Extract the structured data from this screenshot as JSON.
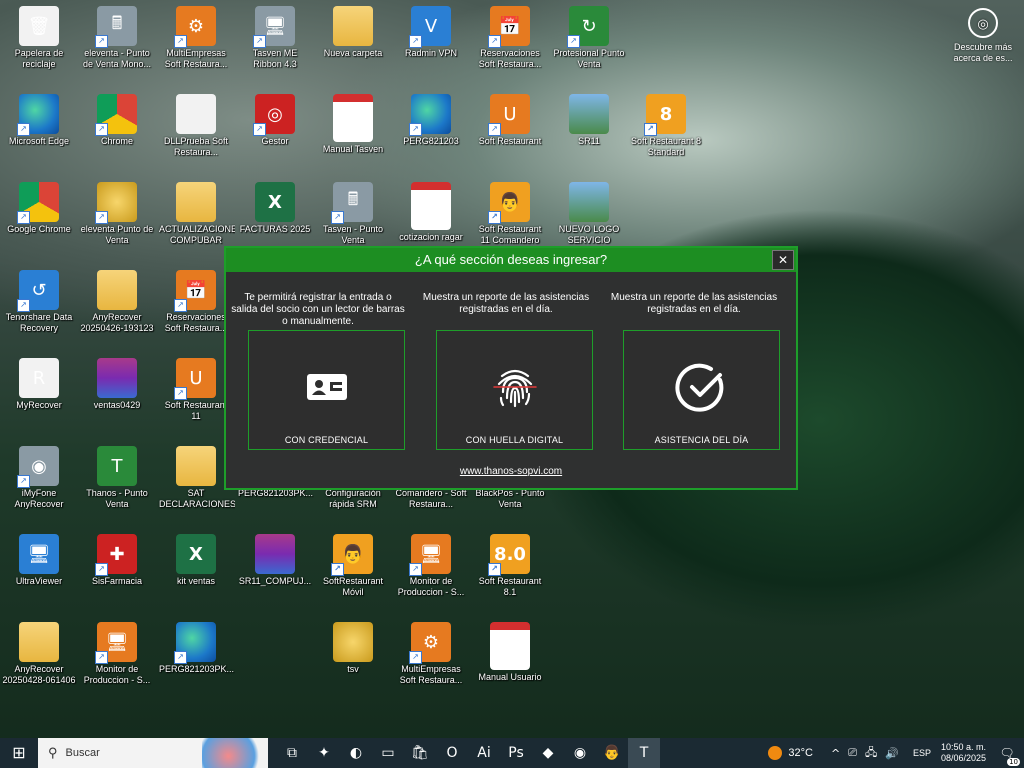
{
  "desktop": {
    "icons": [
      {
        "label": "Papelera de reciclaje",
        "icon": "recycle-bin-icon",
        "glyph": "🗑",
        "cls": "g-white",
        "col": 0,
        "row": 0,
        "shortcut": false
      },
      {
        "label": "eleventa - Punto de Venta Mono...",
        "icon": "pos-terminal-icon",
        "glyph": "🖩",
        "cls": "g-gray",
        "col": 1,
        "row": 0,
        "shortcut": true
      },
      {
        "label": "MultiEmpresas Soft Restaura...",
        "icon": "multiempresas-icon",
        "glyph": "⚙",
        "cls": "g-orange",
        "col": 2,
        "row": 0,
        "shortcut": true
      },
      {
        "label": "Tasven ME Ribbon 4.3",
        "icon": "tasven-icon",
        "glyph": "🖥",
        "cls": "g-gray",
        "col": 3,
        "row": 0,
        "shortcut": true
      },
      {
        "label": "Nueva carpeta",
        "icon": "folder-icon",
        "glyph": "",
        "cls": "g-folder",
        "col": 4,
        "row": 0,
        "shortcut": false
      },
      {
        "label": "Radmin VPN",
        "icon": "radmin-vpn-icon",
        "glyph": "V",
        "cls": "g-blue",
        "col": 5,
        "row": 0,
        "shortcut": true
      },
      {
        "label": "Reservaciones Soft Restaura...",
        "icon": "reservaciones-icon",
        "glyph": "📅",
        "cls": "g-orange",
        "col": 6,
        "row": 0,
        "shortcut": true
      },
      {
        "label": "Protesional Punto Venta",
        "icon": "punto-venta-icon",
        "glyph": "↻",
        "cls": "g-green",
        "col": 7,
        "row": 0,
        "shortcut": true
      },
      {
        "label": "Microsoft Edge",
        "icon": "edge-icon",
        "glyph": "",
        "cls": "g-edge",
        "col": 0,
        "row": 1,
        "shortcut": true
      },
      {
        "label": "Chrome",
        "icon": "chrome-icon",
        "glyph": "",
        "cls": "g-chrome",
        "col": 1,
        "row": 1,
        "shortcut": true
      },
      {
        "label": "DLLPrueba Soft Restaura...",
        "icon": "file-icon",
        "glyph": "",
        "cls": "g-white",
        "col": 2,
        "row": 1,
        "shortcut": false
      },
      {
        "label": "Gestor",
        "icon": "gestor-icon",
        "glyph": "◎",
        "cls": "g-red",
        "col": 3,
        "row": 1,
        "shortcut": true
      },
      {
        "label": "Manual Tasven",
        "icon": "pdf-icon",
        "glyph": "PDF",
        "cls": "g-pdf",
        "col": 4,
        "row": 1,
        "shortcut": false
      },
      {
        "label": "PERG821203",
        "icon": "edge-icon",
        "glyph": "",
        "cls": "g-edge",
        "col": 5,
        "row": 1,
        "shortcut": true
      },
      {
        "label": "Soft Restaurant",
        "icon": "soft-restaurant-icon",
        "glyph": "U",
        "cls": "g-orange",
        "col": 6,
        "row": 1,
        "shortcut": true
      },
      {
        "label": "SR11",
        "icon": "image-icon",
        "glyph": "",
        "cls": "g-img",
        "col": 7,
        "row": 1,
        "shortcut": false
      },
      {
        "label": "Soft Restaurant 8 Standard",
        "icon": "soft-restaurant-8-icon",
        "glyph": "8",
        "cls": "g-sr",
        "col": 8,
        "row": 1,
        "shortcut": true
      },
      {
        "label": "Google Chrome",
        "icon": "chrome-icon",
        "glyph": "",
        "cls": "g-chrome",
        "col": 0,
        "row": 2,
        "shortcut": true
      },
      {
        "label": "eleventa Punto de Venta",
        "icon": "coins-icon",
        "glyph": "",
        "cls": "g-coins",
        "col": 1,
        "row": 2,
        "shortcut": true
      },
      {
        "label": "ACTUALIZACIONES COMPUBAR",
        "icon": "folder-icon",
        "glyph": "",
        "cls": "g-folder",
        "col": 2,
        "row": 2,
        "shortcut": false
      },
      {
        "label": "FACTURAS 2025",
        "icon": "excel-icon",
        "glyph": "X",
        "cls": "g-excel",
        "col": 3,
        "row": 2,
        "shortcut": false
      },
      {
        "label": "Tasven - Punto Venta",
        "icon": "pos-terminal-icon",
        "glyph": "🖩",
        "cls": "g-gray",
        "col": 4,
        "row": 2,
        "shortcut": true
      },
      {
        "label": "cotizacion ragar",
        "icon": "pdf-icon",
        "glyph": "PDF",
        "cls": "g-pdf",
        "col": 5,
        "row": 2,
        "shortcut": false
      },
      {
        "label": "Soft Restaurant 11 Comandero",
        "icon": "comandero-icon",
        "glyph": "👨",
        "cls": "g-sr",
        "col": 6,
        "row": 2,
        "shortcut": true
      },
      {
        "label": "NUEVO LOGO SERVICIO",
        "icon": "image-icon",
        "glyph": "",
        "cls": "g-img",
        "col": 7,
        "row": 2,
        "shortcut": false
      },
      {
        "label": "Tenorshare Data Recovery",
        "icon": "data-recovery-icon",
        "glyph": "↺",
        "cls": "g-blue",
        "col": 0,
        "row": 3,
        "shortcut": true
      },
      {
        "label": "AnyRecover 20250426-193123",
        "icon": "folder-icon",
        "glyph": "",
        "cls": "g-folder",
        "col": 1,
        "row": 3,
        "shortcut": false
      },
      {
        "label": "Reservaciones Soft Restaura...",
        "icon": "reservaciones-icon",
        "glyph": "📅",
        "cls": "g-orange",
        "col": 2,
        "row": 3,
        "shortcut": true
      },
      {
        "label": "MyRecover",
        "icon": "myrecover-icon",
        "glyph": "R",
        "cls": "g-white",
        "col": 0,
        "row": 4,
        "shortcut": false
      },
      {
        "label": "ventas0429",
        "icon": "winrar-icon",
        "glyph": "",
        "cls": "g-rar",
        "col": 1,
        "row": 4,
        "shortcut": false
      },
      {
        "label": "Soft Restaurant 11",
        "icon": "soft-restaurant-icon",
        "glyph": "U",
        "cls": "g-orange",
        "col": 2,
        "row": 4,
        "shortcut": true
      },
      {
        "label": "iMyFone AnyRecover",
        "icon": "anyrecover-icon",
        "glyph": "◉",
        "cls": "g-gray",
        "col": 0,
        "row": 5,
        "shortcut": true
      },
      {
        "label": "Thanos - Punto Venta",
        "icon": "thanos-icon",
        "glyph": "T",
        "cls": "g-green",
        "col": 1,
        "row": 5,
        "shortcut": false
      },
      {
        "label": "SAT DECLARACIONES",
        "icon": "folder-icon",
        "glyph": "",
        "cls": "g-folder",
        "col": 2,
        "row": 5,
        "shortcut": false
      },
      {
        "label": "PERG821203PK...",
        "icon": "file-icon",
        "glyph": "",
        "cls": "g-white",
        "col": 3,
        "row": 5,
        "shortcut": false
      },
      {
        "label": "Configuración rápida SRM",
        "icon": "config-icon",
        "glyph": "⚙",
        "cls": "g-orange",
        "col": 4,
        "row": 5,
        "shortcut": true
      },
      {
        "label": "Comandero - Soft Restaura...",
        "icon": "comandero-icon",
        "glyph": "👨",
        "cls": "g-sr",
        "col": 5,
        "row": 5,
        "shortcut": true
      },
      {
        "label": "BlackPos - Punto Venta",
        "icon": "blackpos-icon",
        "glyph": "▣",
        "cls": "g-gray",
        "col": 6,
        "row": 5,
        "shortcut": true
      },
      {
        "label": "UltraViewer",
        "icon": "ultraviewer-icon",
        "glyph": "🖥",
        "cls": "g-blue",
        "col": 0,
        "row": 6,
        "shortcut": false
      },
      {
        "label": "SisFarmacia",
        "icon": "sisfarmacia-icon",
        "glyph": "✚",
        "cls": "g-red",
        "col": 1,
        "row": 6,
        "shortcut": true
      },
      {
        "label": "kit ventas",
        "icon": "excel-icon",
        "glyph": "X",
        "cls": "g-excel",
        "col": 2,
        "row": 6,
        "shortcut": false
      },
      {
        "label": "SR11_COMPUJ...",
        "icon": "winrar-icon",
        "glyph": "",
        "cls": "g-rar",
        "col": 3,
        "row": 6,
        "shortcut": false
      },
      {
        "label": "SoftRestaurant Móvil",
        "icon": "sr-movil-icon",
        "glyph": "👨",
        "cls": "g-sr",
        "col": 4,
        "row": 6,
        "shortcut": true
      },
      {
        "label": "Monitor de Produccion - S...",
        "icon": "monitor-icon",
        "glyph": "🖥",
        "cls": "g-orange",
        "col": 5,
        "row": 6,
        "shortcut": true
      },
      {
        "label": "Soft Restaurant 8.1",
        "icon": "soft-restaurant-8-icon",
        "glyph": "8.0",
        "cls": "g-sr",
        "col": 6,
        "row": 6,
        "shortcut": true
      },
      {
        "label": "AnyRecover 20250428-061406",
        "icon": "folder-icon",
        "glyph": "",
        "cls": "g-folder",
        "col": 0,
        "row": 7,
        "shortcut": false
      },
      {
        "label": "Monitor de Produccion - S...",
        "icon": "monitor-icon",
        "glyph": "🖥",
        "cls": "g-orange",
        "col": 1,
        "row": 7,
        "shortcut": true
      },
      {
        "label": "PERG821203PK...",
        "icon": "edge-icon",
        "glyph": "",
        "cls": "g-edge",
        "col": 2,
        "row": 7,
        "shortcut": true
      },
      {
        "label": "tsv",
        "icon": "coins-icon",
        "glyph": "",
        "cls": "g-coins",
        "col": 4,
        "row": 7,
        "shortcut": false
      },
      {
        "label": "MultiEmpresas Soft Restaura...",
        "icon": "multiempresas-icon",
        "glyph": "⚙",
        "cls": "g-orange",
        "col": 5,
        "row": 7,
        "shortcut": true
      },
      {
        "label": "Manual Usuario",
        "icon": "pdf-icon",
        "glyph": "PDF",
        "cls": "g-pdf",
        "col": 6,
        "row": 7,
        "shortcut": false
      }
    ],
    "discover": {
      "text": "Descubre más acerca de es...",
      "icon": "camera-icon",
      "glyph": "◎"
    }
  },
  "dialog": {
    "title": "¿A qué sección deseas ingresar?",
    "close": "✕",
    "options": [
      {
        "description": "Te permitirá registrar la entrada o salida del socio con un lector de barras o manualmente.",
        "label": "CON CREDENCIAL",
        "icon": "id-card-icon"
      },
      {
        "description": "Muestra un reporte de las asistencias registradas en el día.",
        "label": "CON HUELLA DIGITAL",
        "icon": "fingerprint-icon"
      },
      {
        "description": "Muestra un reporte de las asistencias registradas en el día.",
        "label": "ASISTENCIA DEL DÍA",
        "icon": "checkmark-icon"
      }
    ],
    "link": "www.thanos-sopvi.com"
  },
  "taskbar": {
    "start_glyph": "⊞",
    "search_placeholder": "Buscar",
    "search_glyph": "⚲",
    "apps": [
      {
        "name": "task-view-icon",
        "glyph": "⧉",
        "active": false
      },
      {
        "name": "copilot-icon",
        "glyph": "✦",
        "active": false
      },
      {
        "name": "edge-taskbar-icon",
        "glyph": "◐",
        "active": false
      },
      {
        "name": "file-explorer-icon",
        "glyph": "▭",
        "active": false
      },
      {
        "name": "store-icon",
        "glyph": "🛍",
        "active": false
      },
      {
        "name": "outlook-icon",
        "glyph": "O",
        "active": false
      },
      {
        "name": "illustrator-icon",
        "glyph": "Ai",
        "active": false
      },
      {
        "name": "photoshop-icon",
        "glyph": "Ps",
        "active": false
      },
      {
        "name": "tasven-taskbar-icon",
        "glyph": "◆",
        "active": false
      },
      {
        "name": "chrome-taskbar-icon",
        "glyph": "◉",
        "active": false
      },
      {
        "name": "comandero-taskbar-icon",
        "glyph": "👨",
        "active": false
      },
      {
        "name": "thanos-taskbar-icon",
        "glyph": "T",
        "active": true
      }
    ],
    "weather": "32°C",
    "tray_glyphs": [
      "^",
      "⎚",
      "🖧",
      "🔊"
    ],
    "lang": "ESP",
    "time": "10:50 a. m.",
    "date": "08/06/2025",
    "notif_glyph": "🗨",
    "notif_count": "10"
  }
}
